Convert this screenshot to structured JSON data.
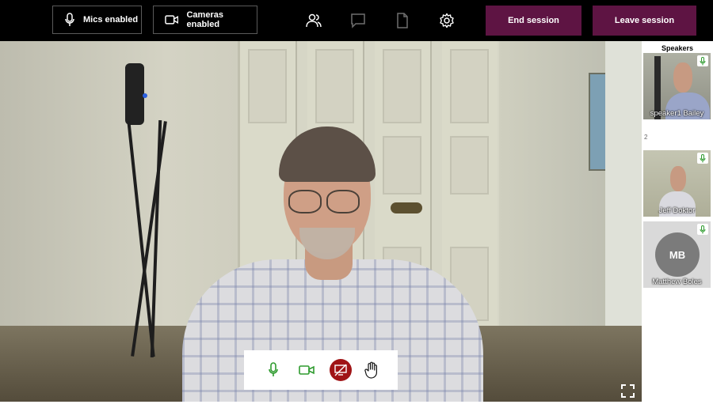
{
  "toolbar": {
    "mics_label": "Mics enabled",
    "cameras_label": "Cameras enabled",
    "end_session_label": "End session",
    "leave_session_label": "Leave session",
    "icons": [
      "participants-icon",
      "chat-icon",
      "document-icon",
      "settings-icon"
    ]
  },
  "sidebar": {
    "title": "Speakers",
    "group_label": "2",
    "speakers": [
      {
        "name": "speaker1 Bailey",
        "mic": "mic-icon"
      },
      {
        "name": "Jeff Doktor",
        "mic": "mic-icon"
      },
      {
        "name": "Matthew Boles",
        "initials": "MB",
        "mic": "mic-icon"
      }
    ]
  },
  "controls": [
    "mic-icon",
    "camera-icon",
    "screen-share-off-icon",
    "raise-hand-icon"
  ],
  "colors": {
    "accent_session": "#5e1443",
    "active_green": "#2e9b2e",
    "screenshare_red": "#a01416",
    "topbar": "#000000"
  }
}
